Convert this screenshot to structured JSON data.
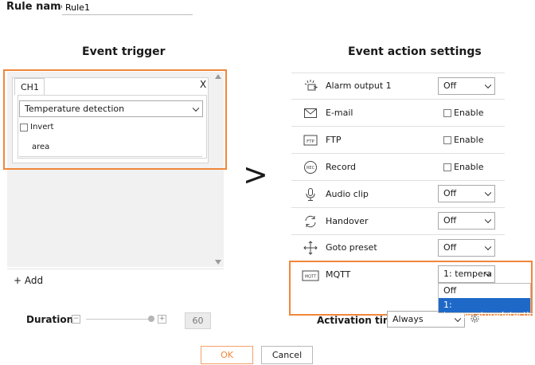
{
  "rule": {
    "label": "Rule name",
    "value": "Rule1"
  },
  "trigger": {
    "title": "Event trigger",
    "channel_tab": "CH1",
    "close_glyph": "X",
    "detection_select": "Temperature detection",
    "invert_label": "Invert",
    "area_label": "area",
    "add_label": "+ Add"
  },
  "duration": {
    "label": "Duration",
    "minus": "−",
    "plus": "+",
    "value": "60"
  },
  "separator_glyph": ">",
  "actions": {
    "title": "Event action settings",
    "enable_label": "Enable",
    "alarm": {
      "label": "Alarm output 1",
      "value": "Off"
    },
    "email": {
      "label": "E-mail"
    },
    "ftp": {
      "label": "FTP",
      "icon_text": "FTP"
    },
    "record": {
      "label": "Record",
      "icon_text": "REC"
    },
    "audio": {
      "label": "Audio clip",
      "value": "Off"
    },
    "handover": {
      "label": "Handover",
      "value": "Off"
    },
    "goto": {
      "label": "Goto preset",
      "value": "Off"
    },
    "mqtt": {
      "label": "MQTT",
      "icon_text": "MQTT",
      "value": "1: tempera",
      "options": [
        "Off",
        "1: temperaturedetection"
      ]
    }
  },
  "activation": {
    "label": "Activation time",
    "value": "Always"
  },
  "buttons": {
    "ok": "OK",
    "cancel": "Cancel"
  },
  "colors": {
    "highlight": "#f0863a",
    "selected": "#1e69c8"
  }
}
